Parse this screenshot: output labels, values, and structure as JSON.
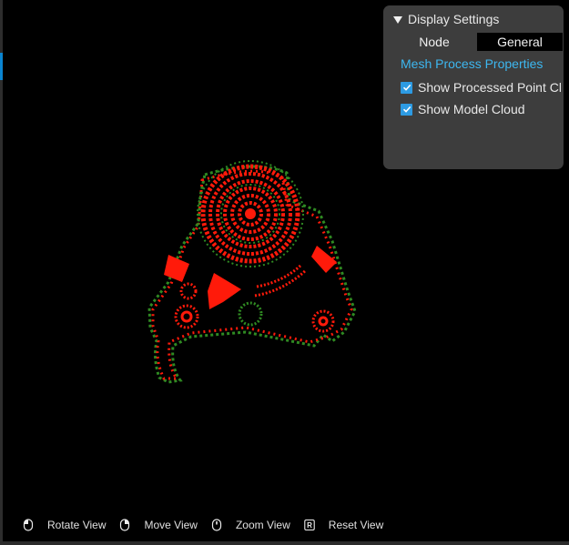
{
  "panel": {
    "title": "Display Settings",
    "tabs": [
      {
        "label": "Node",
        "active": false
      },
      {
        "label": "General",
        "active": true
      }
    ],
    "section_link": "Mesh Process Properties",
    "options": [
      {
        "label": "Show Processed Point Cl",
        "checked": true
      },
      {
        "label": "Show Model Cloud",
        "checked": true
      }
    ]
  },
  "hints": [
    {
      "icon": "mouse-left-icon",
      "label": "Rotate View"
    },
    {
      "icon": "mouse-right-icon",
      "label": "Move View"
    },
    {
      "icon": "mouse-wheel-icon",
      "label": "Zoom View"
    },
    {
      "icon": "r-key-icon",
      "label": "Reset View"
    }
  ],
  "colors": {
    "processed_points": "#ff1a0a",
    "model_points": "#2f8a22",
    "accent": "#3db7f0",
    "panel_bg": "#3d3d3d"
  }
}
